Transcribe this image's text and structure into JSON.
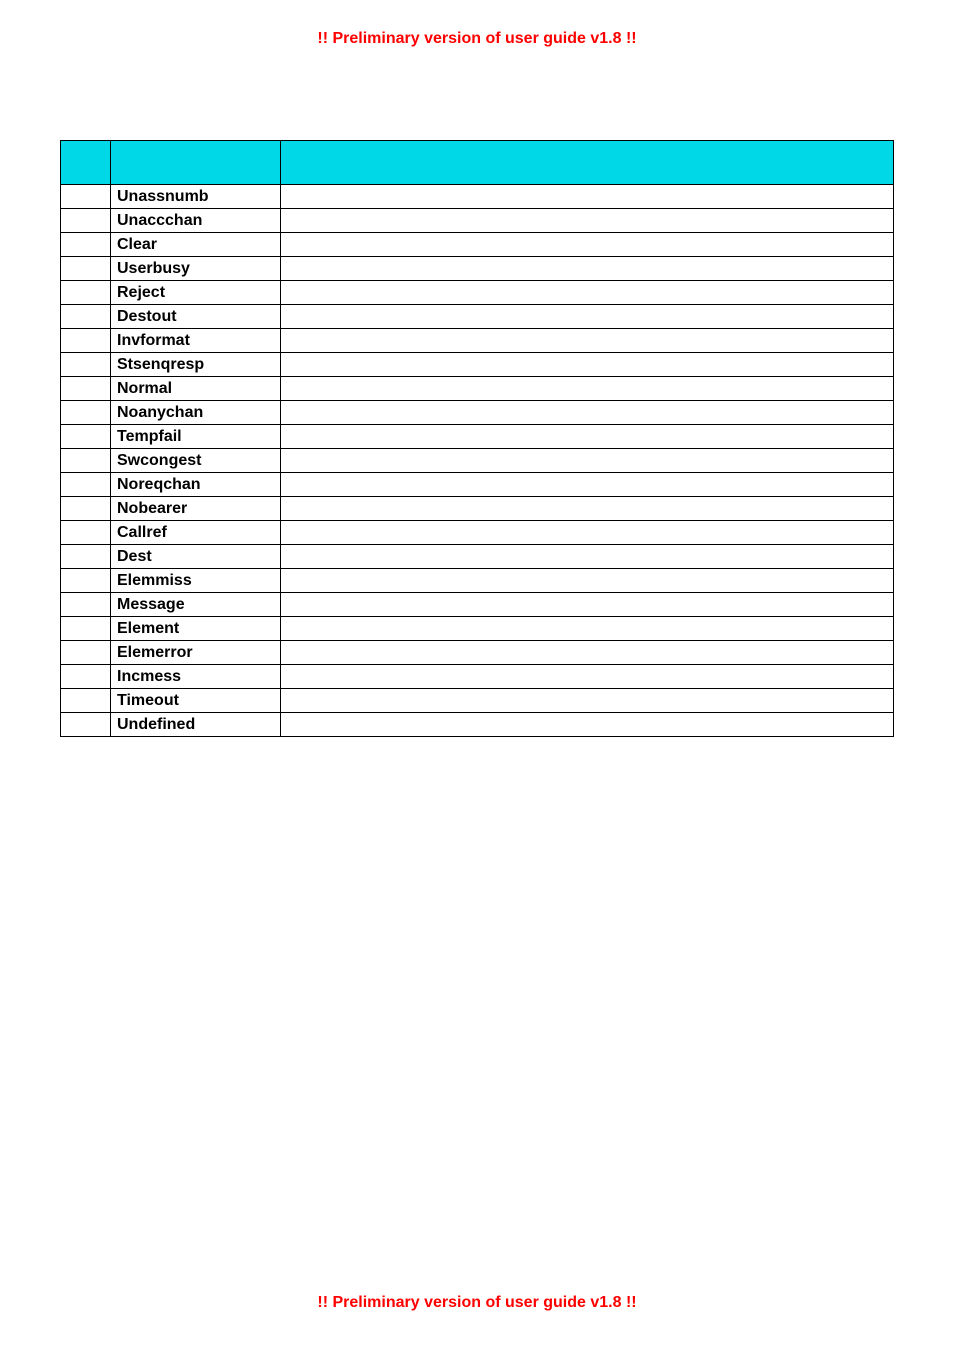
{
  "banner": "!! Preliminary version of user guide v1.8 !!",
  "rows": [
    {
      "c0": "",
      "c1": "Unassnumb",
      "c2": ""
    },
    {
      "c0": "",
      "c1": "Unaccchan",
      "c2": ""
    },
    {
      "c0": "",
      "c1": "Clear",
      "c2": ""
    },
    {
      "c0": "",
      "c1": "Userbusy",
      "c2": ""
    },
    {
      "c0": "",
      "c1": "Reject",
      "c2": ""
    },
    {
      "c0": "",
      "c1": "Destout",
      "c2": ""
    },
    {
      "c0": "",
      "c1": "Invformat",
      "c2": ""
    },
    {
      "c0": "",
      "c1": "Stsenqresp",
      "c2": ""
    },
    {
      "c0": "",
      "c1": "Normal",
      "c2": ""
    },
    {
      "c0": "",
      "c1": "Noanychan",
      "c2": ""
    },
    {
      "c0": "",
      "c1": "Tempfail",
      "c2": ""
    },
    {
      "c0": "",
      "c1": "Swcongest",
      "c2": ""
    },
    {
      "c0": "",
      "c1": "Noreqchan",
      "c2": ""
    },
    {
      "c0": "",
      "c1": "Nobearer",
      "c2": ""
    },
    {
      "c0": "",
      "c1": "Callref",
      "c2": ""
    },
    {
      "c0": "",
      "c1": "Dest",
      "c2": ""
    },
    {
      "c0": "",
      "c1": "Elemmiss",
      "c2": ""
    },
    {
      "c0": "",
      "c1": "Message",
      "c2": ""
    },
    {
      "c0": "",
      "c1": "Element",
      "c2": ""
    },
    {
      "c0": "",
      "c1": "Elemerror",
      "c2": ""
    },
    {
      "c0": "",
      "c1": "Incmess",
      "c2": ""
    },
    {
      "c0": "",
      "c1": "Timeout",
      "c2": ""
    },
    {
      "c0": "",
      "c1": "Undefined",
      "c2": ""
    }
  ]
}
